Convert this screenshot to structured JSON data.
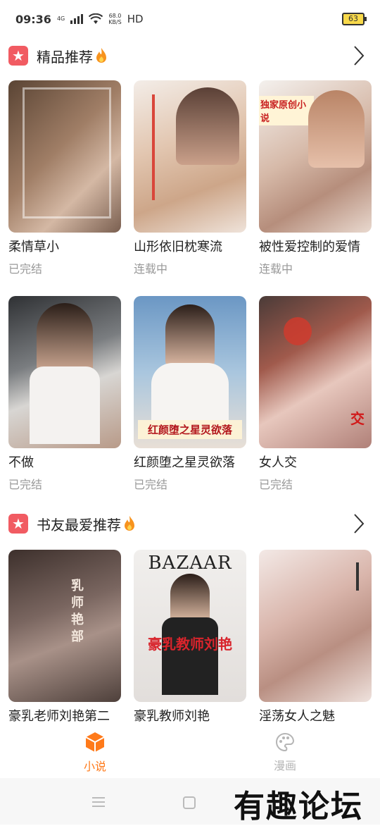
{
  "status_bar": {
    "time": "09:36",
    "network": "4G",
    "speed_value": "68.0",
    "speed_unit": "KB/S",
    "hd": "HD",
    "battery": "63"
  },
  "sections": [
    {
      "title": "精品推荐",
      "books": [
        {
          "title": "柔情草小",
          "status": "已完结",
          "cover_text": "",
          "cover_bg": "#8a6a55"
        },
        {
          "title": "山形依旧枕寒流",
          "status": "连载中",
          "cover_text": "",
          "cover_bg": "#e8d8cc"
        },
        {
          "title": "被性爱控制的爱情",
          "status": "连载中",
          "cover_text": "独家原创小说",
          "cover_bg": "#c9a796"
        },
        {
          "title": "不做",
          "status": "已完结",
          "cover_text": "",
          "cover_bg": "#6c6f73"
        },
        {
          "title": "红颜堕之星灵欲落",
          "status": "已完结",
          "cover_text": "红颜堕之星灵欲落",
          "cover_bg": "#7ba5c9"
        },
        {
          "title": "女人交",
          "status": "已完结",
          "cover_text": "交",
          "cover_bg": "#9a6a62"
        }
      ]
    },
    {
      "title": "书友最爱推荐",
      "books": [
        {
          "title": "豪乳老师刘艳第二",
          "status": "",
          "cover_text": "乳师艳部",
          "cover_bg": "#5b4a44"
        },
        {
          "title": "豪乳教师刘艳",
          "status": "",
          "cover_text": "豪乳教师刘艳",
          "cover_sub": "BAZAAR",
          "cover_bg": "#e9e7e6"
        },
        {
          "title": "淫荡女人之魅",
          "status": "",
          "cover_text": "",
          "cover_bg": "#d8b3a8"
        }
      ]
    }
  ],
  "bottom_nav": [
    {
      "label": "小说",
      "icon": "novel-cube-icon",
      "active": true
    },
    {
      "label": "漫画",
      "icon": "comic-palette-icon",
      "active": false
    }
  ],
  "watermark": "有趣论坛",
  "colors": {
    "accent": "#ff7a1a",
    "badge": "#f15b62",
    "muted": "#999999"
  }
}
